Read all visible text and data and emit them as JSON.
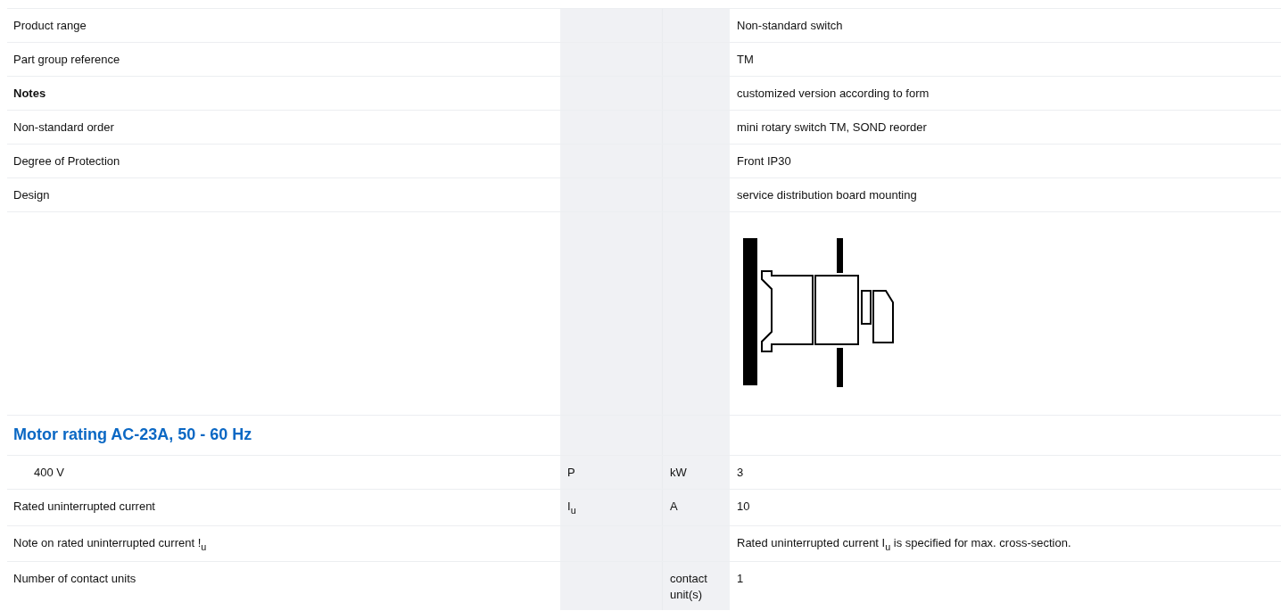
{
  "rows": [
    {
      "kind": "text",
      "label": "Product range",
      "bold": false,
      "symbol": "",
      "unit": "",
      "value": "Non-standard switch"
    },
    {
      "kind": "text",
      "label": "Part group reference",
      "bold": false,
      "symbol": "",
      "unit": "",
      "value": "TM"
    },
    {
      "kind": "text",
      "label": "Notes",
      "bold": true,
      "symbol": "",
      "unit": "",
      "value": "customized version according to form"
    },
    {
      "kind": "text",
      "label": "Non-standard order",
      "bold": false,
      "symbol": "",
      "unit": "",
      "value": "mini rotary switch TM, SOND reorder"
    },
    {
      "kind": "text",
      "label": "Degree of Protection",
      "bold": false,
      "symbol": "",
      "unit": "",
      "value": "Front IP30"
    },
    {
      "kind": "text",
      "label": "Design",
      "bold": false,
      "symbol": "",
      "unit": "",
      "value": "service distribution board mounting"
    },
    {
      "kind": "image"
    },
    {
      "kind": "heading",
      "label": "Motor rating AC-23A, 50 - 60 Hz",
      "children": [
        {
          "kind": "text",
          "label": "400 V",
          "bold": false,
          "symbol": "P",
          "unit": "kW",
          "value": "3"
        }
      ]
    },
    {
      "kind": "text",
      "label": "Rated uninterrupted current",
      "bold": false,
      "symbol": "I$_{u}$",
      "unit": "A",
      "value": "10"
    },
    {
      "kind": "text",
      "label": "Note on rated uninterrupted current !$_{u}$",
      "bold": false,
      "symbol": "",
      "unit": "",
      "value": "Rated uninterrupted current I$_{u}$ is specified for max. cross-section."
    },
    {
      "kind": "text",
      "label": "Number of contact units",
      "bold": false,
      "symbol": "",
      "unit": "contact unit(s)",
      "value": "1"
    }
  ]
}
